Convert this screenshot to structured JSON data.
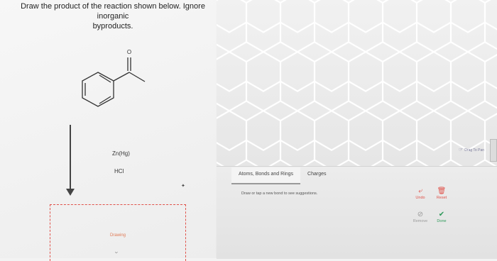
{
  "question": {
    "line1": "Draw the product of the reaction shown below. Ignore inorganic",
    "line2": "byproducts."
  },
  "molecule": {
    "oxygen_label": "O",
    "name": "acetophenone"
  },
  "reaction": {
    "reagent1": "Zn(Hg)",
    "reagent2": "HCl"
  },
  "answer_box": {
    "label": "Drawing",
    "expand_icon": "chevron-down-icon"
  },
  "canvas": {
    "drag_label": "Drag To Pan",
    "drag_icon": "hand-icon",
    "grid_color": "#ffffff"
  },
  "panel": {
    "tabs": [
      "Atoms, Bonds and Rings",
      "Charges"
    ],
    "hint": "Draw or tap a new bond to see suggestions.",
    "controls": {
      "undo": "Undo",
      "reset": "Reset",
      "remove": "Remove",
      "done": "Done"
    }
  },
  "colors": {
    "accent_red": "#e0524a",
    "done_green": "#2e9a5a",
    "remove_gray": "#9a9a9a"
  }
}
